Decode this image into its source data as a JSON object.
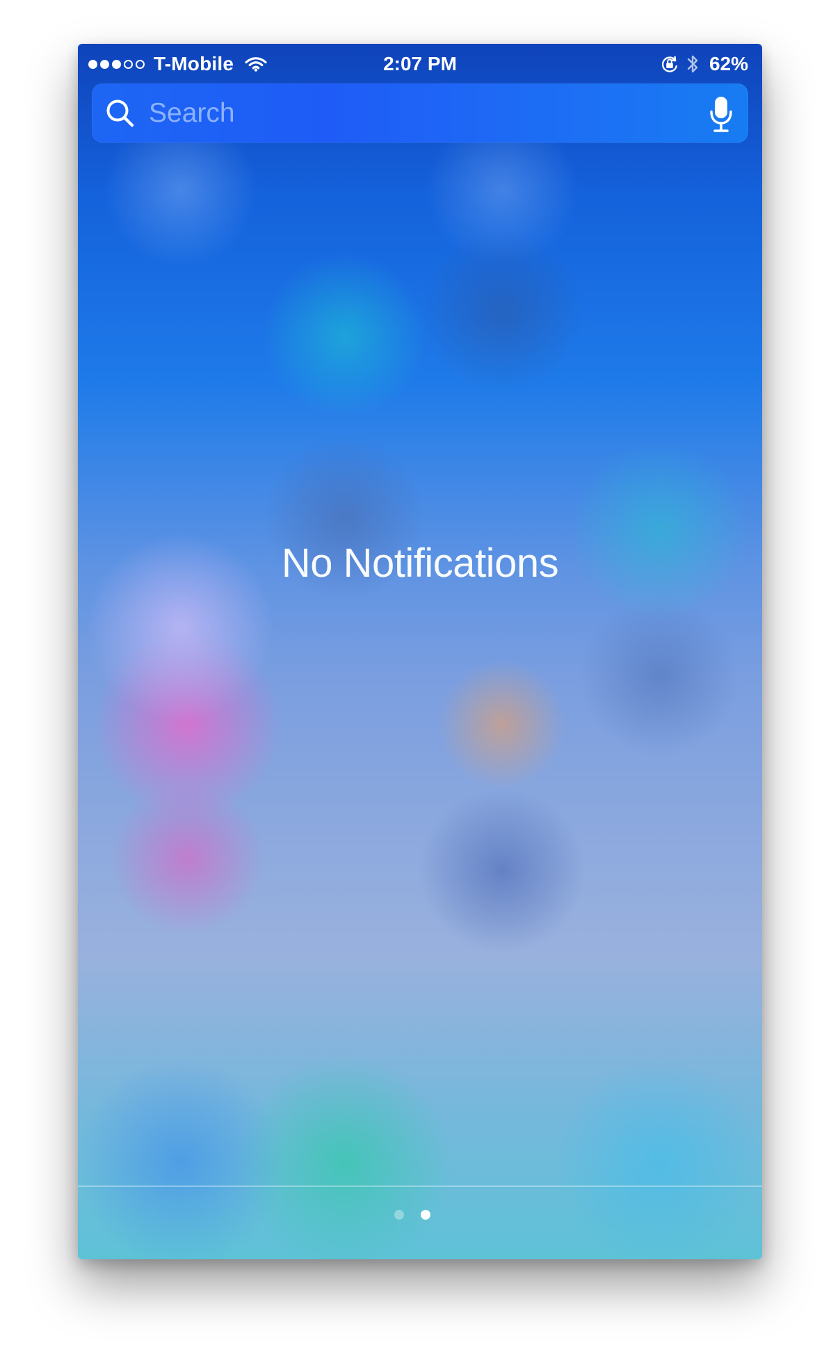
{
  "statusbar": {
    "signal_bars_total": 5,
    "signal_bars_filled": 3,
    "carrier": "T-Mobile",
    "time": "2:07 PM",
    "battery": "62%",
    "icons": [
      "wifi-icon",
      "orientation-lock-icon",
      "bluetooth-icon"
    ]
  },
  "search": {
    "placeholder": "Search",
    "left_icon": "search-icon",
    "right_icon": "microphone-icon"
  },
  "main": {
    "empty_message": "No Notifications"
  },
  "pagination": {
    "total_pages": 2,
    "active_page": 2
  },
  "colors": {
    "text_primary": "#ffffff",
    "search_field": "#1f5cf7",
    "background_top": "#0f43ba",
    "background_middle": "#8aa7de",
    "background_bottom": "#5ec2d7"
  }
}
